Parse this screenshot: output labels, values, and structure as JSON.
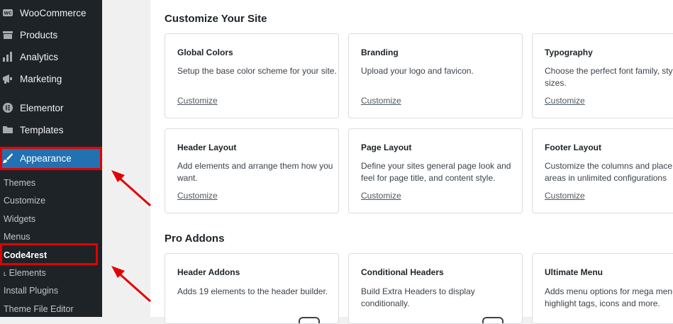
{
  "sidebar": {
    "items": [
      {
        "label": "WooCommerce",
        "icon": "woocommerce-icon"
      },
      {
        "label": "Products",
        "icon": "products-icon"
      },
      {
        "label": "Analytics",
        "icon": "analytics-icon"
      },
      {
        "label": "Marketing",
        "icon": "megaphone-icon"
      },
      {
        "label": "Elementor",
        "icon": "elementor-icon"
      },
      {
        "label": "Templates",
        "icon": "folder-icon"
      },
      {
        "label": "Appearance",
        "icon": "paintbrush-icon"
      }
    ],
    "submenu": [
      "Themes",
      "Customize",
      "Widgets",
      "Menus",
      "Code4rest",
      "˪ Elements",
      "Install Plugins",
      "Theme File Editor"
    ]
  },
  "main": {
    "sections": [
      {
        "title": "Customize Your Site",
        "cards": [
          {
            "title": "Global Colors",
            "desc": "Setup the base color scheme for your site.",
            "link": "Customize"
          },
          {
            "title": "Branding",
            "desc": "Upload your logo and favicon.",
            "link": "Customize"
          },
          {
            "title": "Typography",
            "desc": "Choose the perfect font family, style and sizes.",
            "link": "Customize"
          },
          {
            "title": "Header Layout",
            "desc": "Add elements and arrange them how you want.",
            "link": "Customize"
          },
          {
            "title": "Page Layout",
            "desc": "Define your sites general page look and feel for page title, and content style.",
            "link": "Customize"
          },
          {
            "title": "Footer Layout",
            "desc": "Customize the columns and place widget areas in unlimited configurations",
            "link": "Customize"
          }
        ]
      },
      {
        "title": "Pro Addons",
        "cards": [
          {
            "title": "Header Addons",
            "desc": "Adds 19 elements to the header builder."
          },
          {
            "title": "Conditional Headers",
            "desc": "Build Extra Headers to display conditionally."
          },
          {
            "title": "Ultimate Menu",
            "desc": "Adds menu options for mega menus, highlight tags, icons and more."
          }
        ]
      }
    ]
  },
  "colors": {
    "sidebar_bg": "#1d2327",
    "active_bg": "#2271b1",
    "highlight": "#e20000"
  }
}
